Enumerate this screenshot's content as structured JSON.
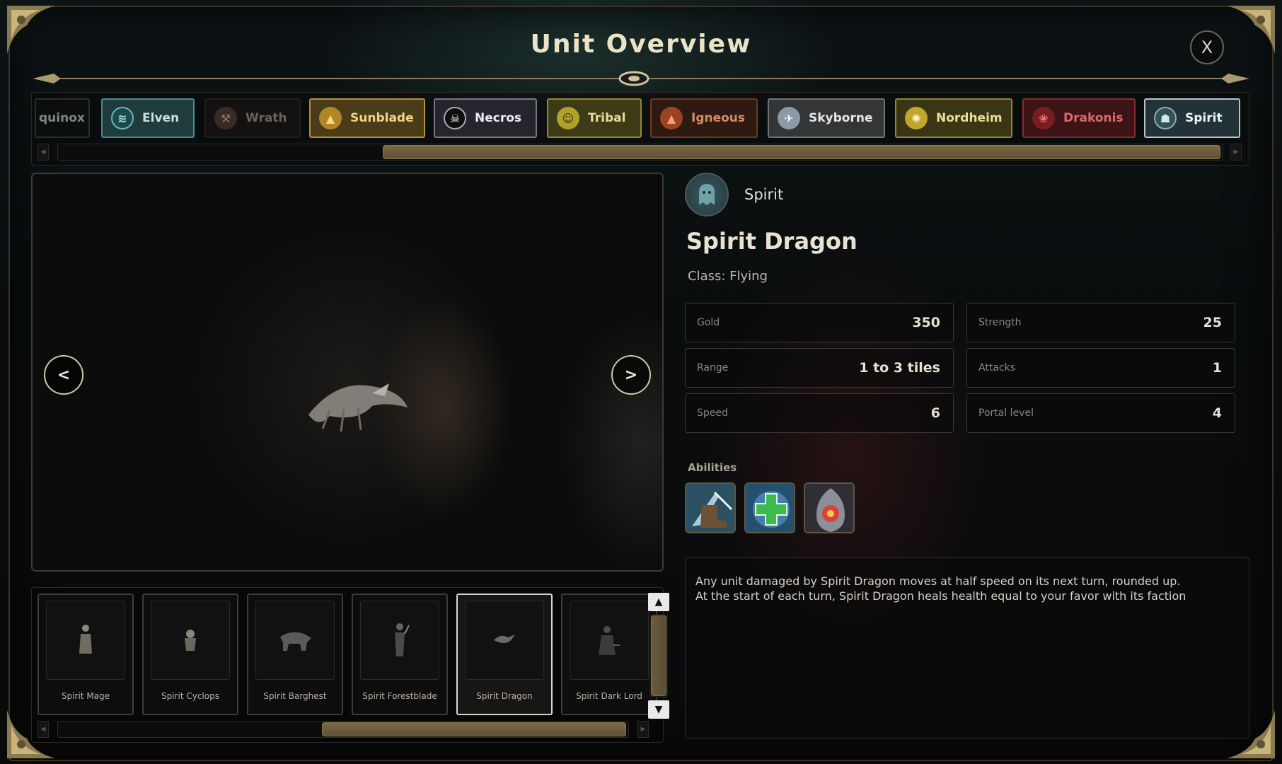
{
  "header": {
    "title": "Unit Overview",
    "close_label": "X"
  },
  "factions": [
    {
      "key": "equinox",
      "label": "quinox",
      "icon": "equinox-icon",
      "selected": false
    },
    {
      "key": "elven",
      "label": "Elven",
      "icon": "elven-swirl-icon",
      "selected": false
    },
    {
      "key": "wrath",
      "label": "Wrath",
      "icon": "wrath-axe-icon",
      "selected": false
    },
    {
      "key": "sunblade",
      "label": "Sunblade",
      "icon": "sun-triangle-icon",
      "selected": false
    },
    {
      "key": "necros",
      "label": "Necros",
      "icon": "skull-icon",
      "selected": false
    },
    {
      "key": "tribal",
      "label": "Tribal",
      "icon": "tribal-mask-icon",
      "selected": false
    },
    {
      "key": "igneous",
      "label": "Igneous",
      "icon": "volcano-icon",
      "selected": false
    },
    {
      "key": "skyborne",
      "label": "Skyborne",
      "icon": "bird-icon",
      "selected": false
    },
    {
      "key": "nordheim",
      "label": "Nordheim",
      "icon": "snowflake-icon",
      "selected": false
    },
    {
      "key": "drakonis",
      "label": "Drakonis",
      "icon": "dragon-head-icon",
      "selected": false
    },
    {
      "key": "spirit",
      "label": "Spirit",
      "icon": "ghost-icon",
      "selected": true
    }
  ],
  "preview": {
    "prev_label": "<",
    "next_label": ">"
  },
  "units": [
    {
      "name": "Spirit Mage",
      "selected": false
    },
    {
      "name": "Spirit Cyclops",
      "selected": false
    },
    {
      "name": "Spirit Barghest",
      "selected": false
    },
    {
      "name": "Spirit Forestblade",
      "selected": false
    },
    {
      "name": "Spirit Dragon",
      "selected": true
    },
    {
      "name": "Spirit Dark Lord",
      "selected": false
    }
  ],
  "scroll": {
    "up_label": "▲",
    "down_label": "▼"
  },
  "details": {
    "faction": "Spirit",
    "unit_name": "Spirit Dragon",
    "class_line": "Class: Flying",
    "stats": [
      {
        "label": "Gold",
        "value": "350"
      },
      {
        "label": "Strength",
        "value": "25"
      },
      {
        "label": "Range",
        "value": "1 to 3 tiles"
      },
      {
        "label": "Attacks",
        "value": "1"
      },
      {
        "label": "Speed",
        "value": "6"
      },
      {
        "label": "Portal level",
        "value": "4"
      }
    ],
    "abilities_label": "Abilities",
    "abilities": [
      "frost-boot-icon",
      "heal-cross-icon",
      "flame-shield-icon"
    ],
    "description": [
      "Any unit damaged by Spirit Dragon moves at half speed on its next turn, rounded up.",
      "At the start of each turn, Spirit Dragon heals health equal to your favor with its faction"
    ]
  },
  "colors": {
    "accent_gold": "#b4913a",
    "frame": "#3b3426",
    "text": "#d9d3c4"
  }
}
